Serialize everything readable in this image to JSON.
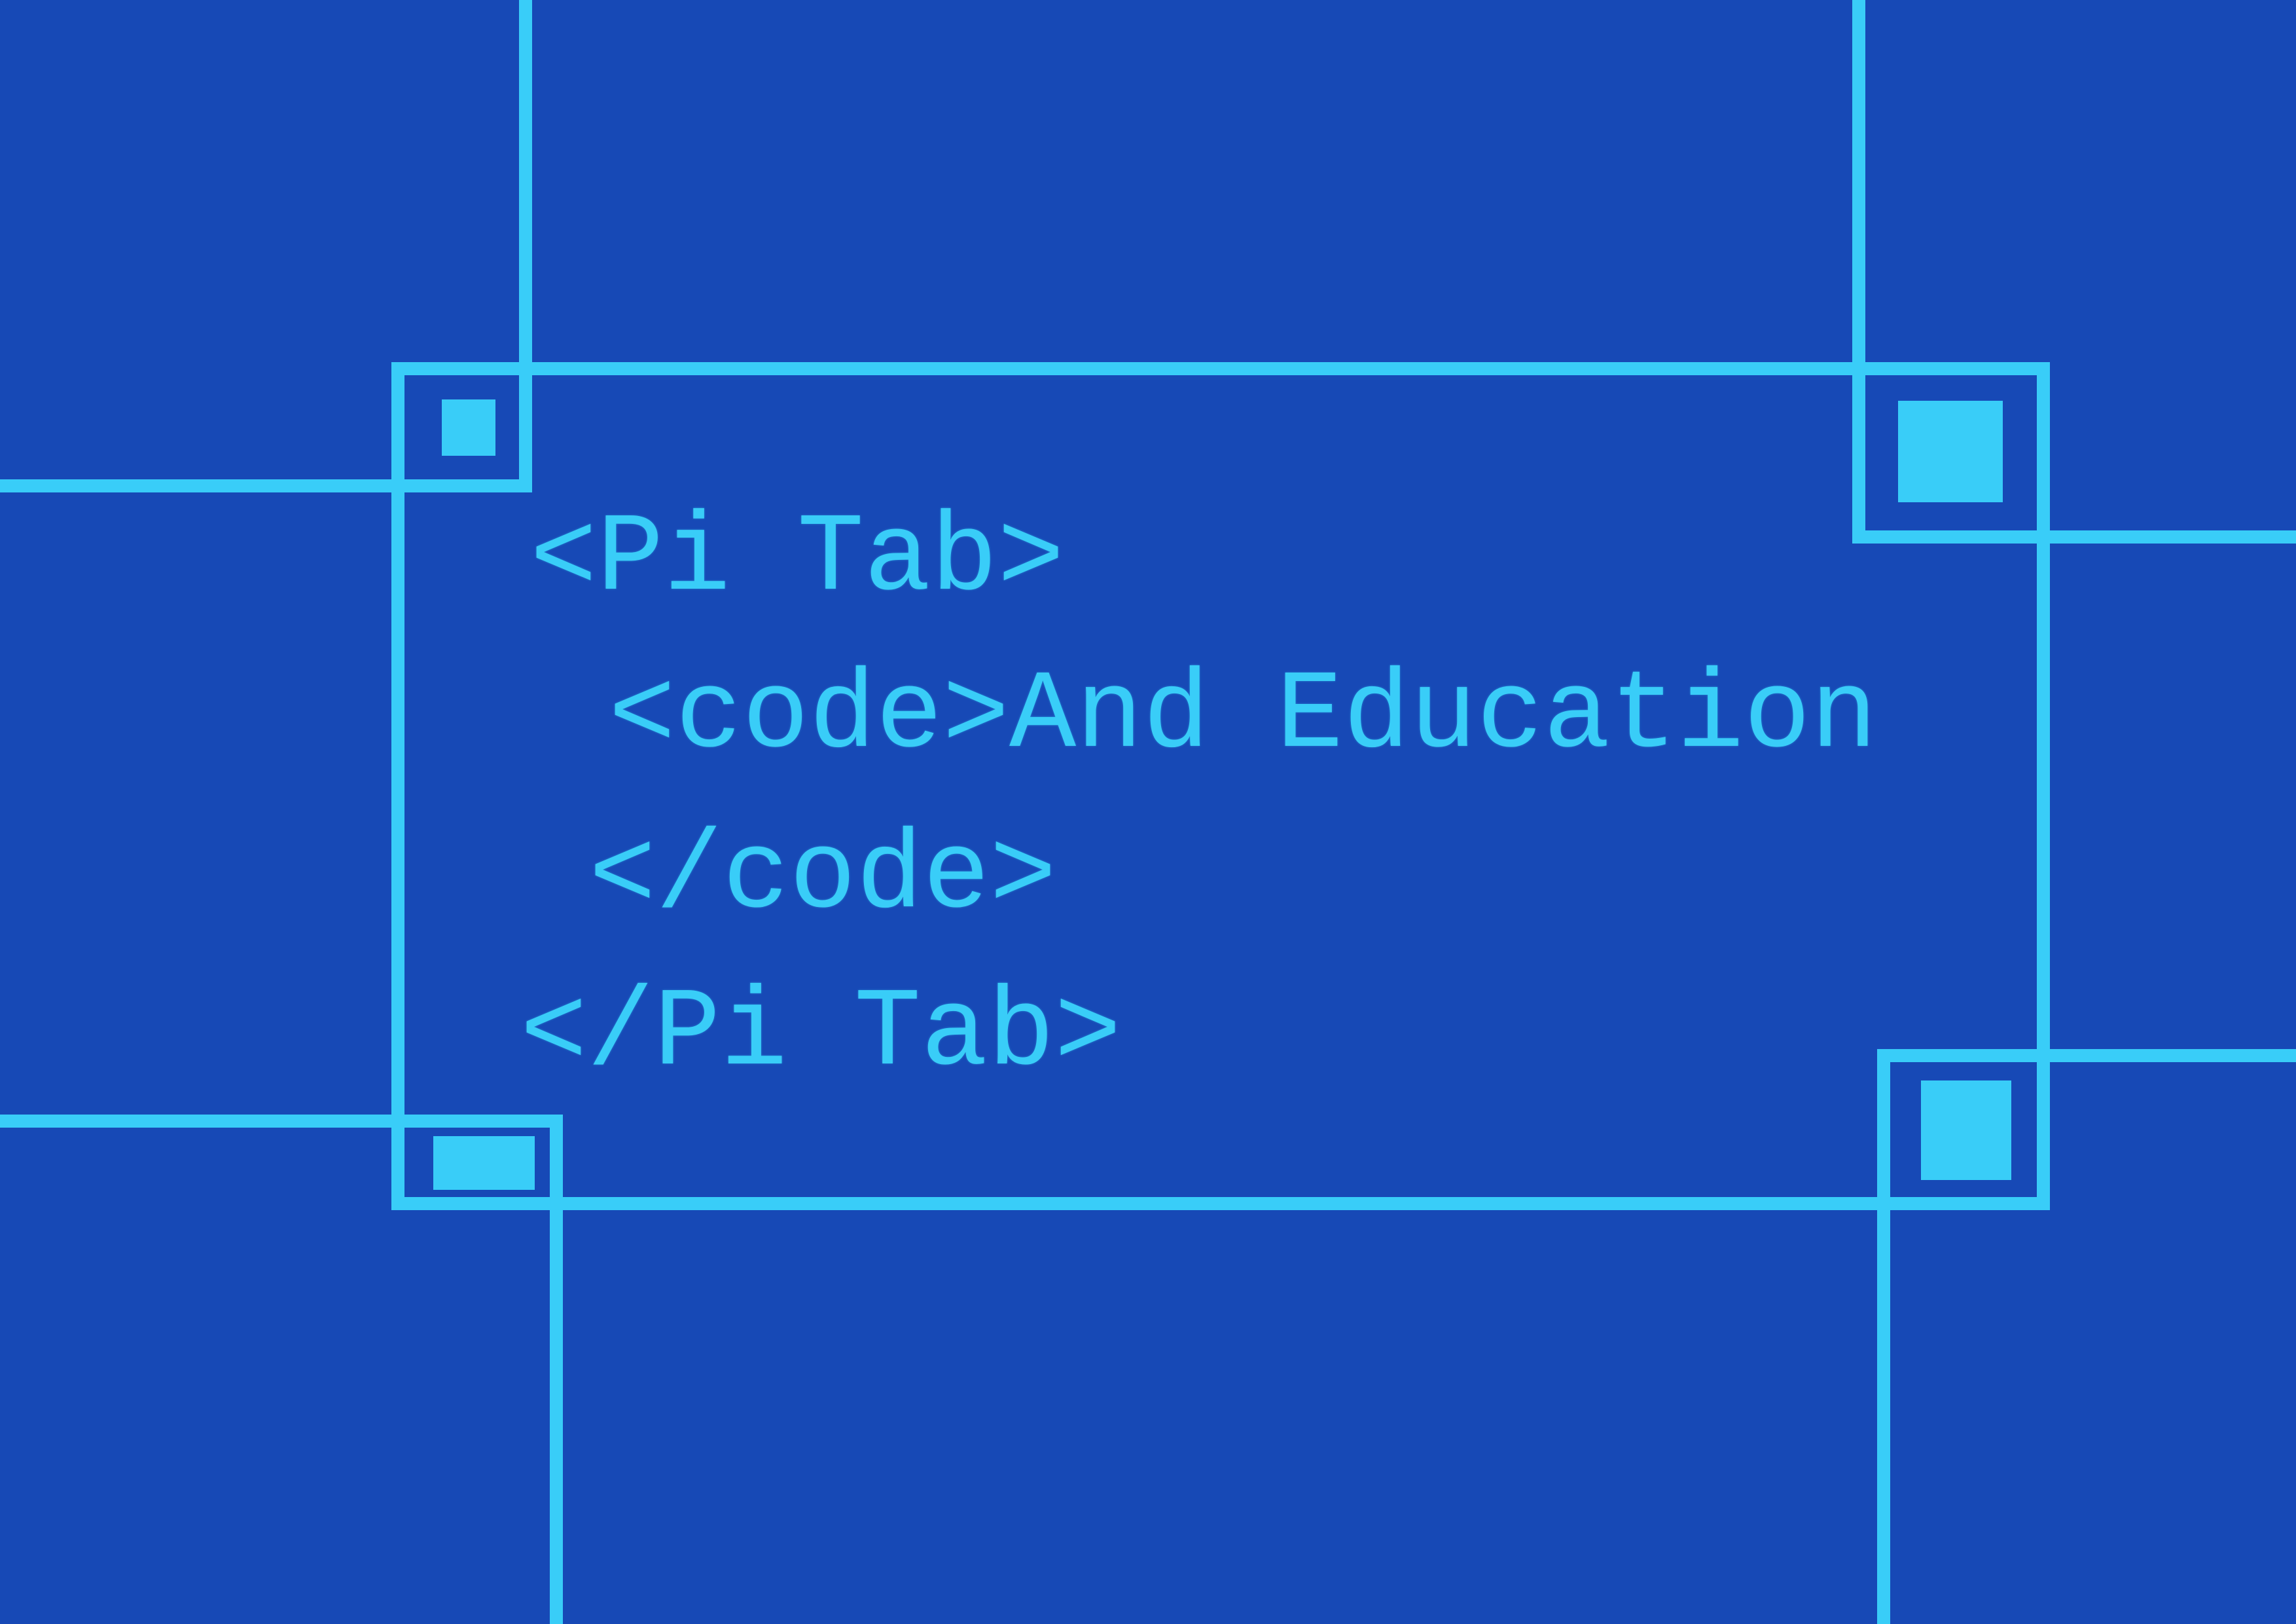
{
  "colors": {
    "background": "#1749b6",
    "accent": "#39cdf8"
  },
  "code_lines": {
    "line1": "<Pi Tab>",
    "line2": "<code>And Education",
    "line3": "</code>",
    "line4": "</Pi Tab>"
  }
}
